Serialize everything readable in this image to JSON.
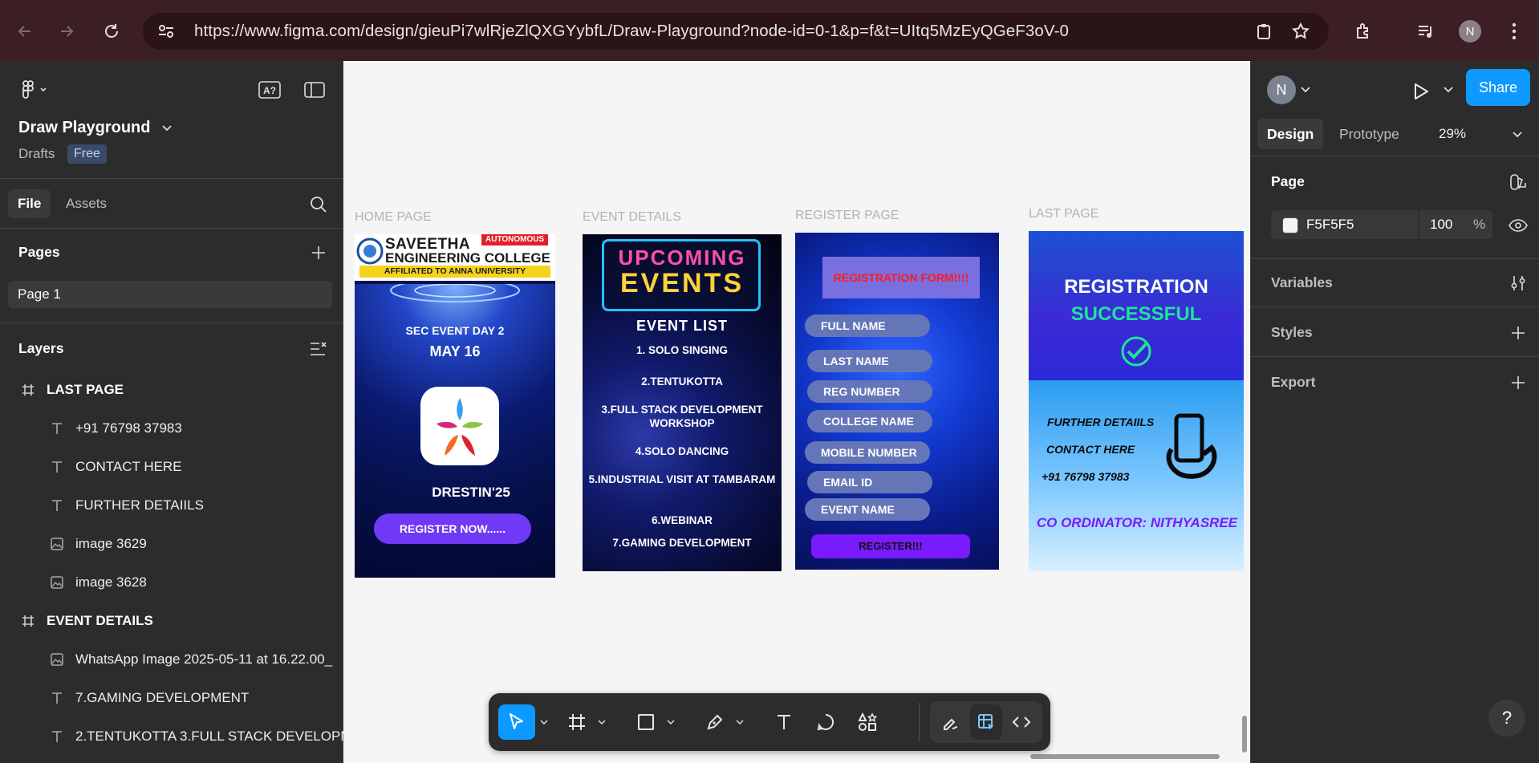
{
  "browser": {
    "url": "https://www.figma.com/design/gieuPi7wlRjeZlQXGYybfL/Draw-Playground?node-id=0-1&p=f&t=UItq5MzEyQGeF3oV-0",
    "profile_initial": "N"
  },
  "file": {
    "name": "Draw Playground",
    "location": "Drafts",
    "plan_badge": "Free"
  },
  "left_panel": {
    "tabs": [
      "File",
      "Assets"
    ],
    "pages_heading": "Pages",
    "pages": [
      "Page 1"
    ],
    "layers_heading": "Layers",
    "layers": [
      {
        "type": "frame",
        "name": "LAST PAGE"
      },
      {
        "type": "text",
        "name": "+91 76798 37983"
      },
      {
        "type": "text",
        "name": "CONTACT HERE"
      },
      {
        "type": "text",
        "name": "FURTHER DETAIILS"
      },
      {
        "type": "image",
        "name": "image 3629"
      },
      {
        "type": "image",
        "name": "image 3628"
      },
      {
        "type": "frame",
        "name": "EVENT DETAILS"
      },
      {
        "type": "image",
        "name": "WhatsApp Image 2025-05-11 at 16.22.00_"
      },
      {
        "type": "text",
        "name": "7.GAMING DEVELOPMENT"
      },
      {
        "type": "text",
        "name": "2.TENTUKOTTA 3.FULL STACK DEVELOPM"
      }
    ]
  },
  "canvas": {
    "background": "#F5F5F5",
    "frames": {
      "home": {
        "label": "HOME PAGE",
        "college_line1": "SAVEETHA",
        "college_line2": "ENGINEERING COLLEGE",
        "autonomous": "AUTONOMOUS",
        "affiliation": "AFFILIATED TO ANNA UNIVERSITY",
        "event_day": "SEC EVENT DAY 2",
        "date": "MAY 16",
        "event_name": "DRESTIN'25",
        "cta": "REGISTER  NOW......"
      },
      "events": {
        "label": "EVENT DETAILS",
        "neon_top": "UPCOMING",
        "neon_bottom": "EVENTS",
        "list_title": "EVENT  LIST",
        "items": [
          "1. SOLO SINGING",
          "2.TENTUKOTTA",
          "3.FULL STACK DEVELOPMENT WORKSHOP",
          "4.SOLO DANCING",
          "5.INDUSTRIAL VISIT AT TAMBARAM",
          "6.WEBINAR",
          "7.GAMING DEVELOPMENT"
        ]
      },
      "register": {
        "label": "REGISTER PAGE",
        "title": "REGISTRATION FORM!!!!",
        "fields": [
          "FULL NAME",
          "LAST NAME",
          "REG NUMBER",
          "COLLEGE NAME",
          "MOBILE NUMBER",
          "EMAIL ID",
          "EVENT NAME"
        ],
        "submit": "REGISTER!!!"
      },
      "last": {
        "label": "LAST PAGE",
        "title1": "REGISTRATION",
        "title2": "SUCCESSFUL",
        "further": "FURTHER DETAIILS",
        "contact": "CONTACT HERE",
        "phone": "+91 76798 37983",
        "coordinator": "CO ORDINATOR: NITHYASREE"
      }
    }
  },
  "right_panel": {
    "avatar_initial": "N",
    "share_label": "Share",
    "tabs": [
      "Design",
      "Prototype"
    ],
    "zoom": "29%",
    "page_section": "Page",
    "page_color": "F5F5F5",
    "page_opacity": "100",
    "opacity_unit": "%",
    "variables": "Variables",
    "styles": "Styles",
    "export": "Export",
    "help": "?"
  },
  "colors": {
    "accent": "#0d99ff",
    "panel_bg": "#2c2c2c",
    "canvas_bg": "#f5f5f5",
    "browser_frame": "#3b1f24"
  }
}
